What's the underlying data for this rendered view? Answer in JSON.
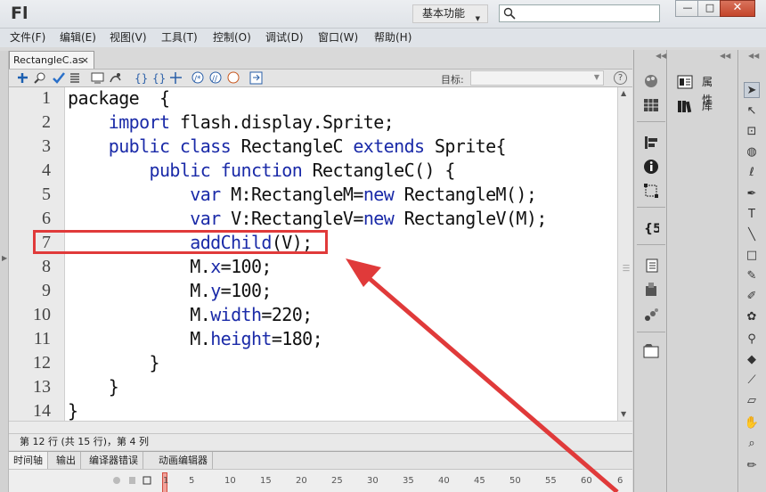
{
  "titlebar": {
    "logo": "Fl",
    "workspace": "基本功能",
    "window_buttons": {
      "minimize": "—",
      "maximize": "□",
      "close": "✕"
    }
  },
  "menubar": [
    "文件(F)",
    "编辑(E)",
    "视图(V)",
    "工具(T)",
    "控制(O)",
    "调试(D)",
    "窗口(W)",
    "帮助(H)"
  ],
  "document_tab": {
    "label": "RectangleC.as",
    "close": "×"
  },
  "toolbar": {
    "target_label": "目标:",
    "target_value": "",
    "help": "?"
  },
  "editor": {
    "line_numbers": [
      "1",
      "2",
      "3",
      "4",
      "5",
      "6",
      "7",
      "8",
      "9",
      "10",
      "11",
      "12",
      "13",
      "14"
    ],
    "highlighted_line": 7,
    "lines": [
      [
        {
          "t": "package  {",
          "k": false
        }
      ],
      [
        {
          "t": "    ",
          "k": false
        },
        {
          "t": "import",
          "k": true
        },
        {
          "t": " flash.display.Sprite;",
          "k": false
        }
      ],
      [
        {
          "t": "    ",
          "k": false
        },
        {
          "t": "public class",
          "k": true
        },
        {
          "t": " RectangleC ",
          "k": false
        },
        {
          "t": "extends",
          "k": true
        },
        {
          "t": " Sprite{",
          "k": false
        }
      ],
      [
        {
          "t": "        ",
          "k": false
        },
        {
          "t": "public function",
          "k": true
        },
        {
          "t": " RectangleC() {",
          "k": false
        }
      ],
      [
        {
          "t": "            ",
          "k": false
        },
        {
          "t": "var",
          "k": true
        },
        {
          "t": " M:RectangleM=",
          "k": false
        },
        {
          "t": "new",
          "k": true
        },
        {
          "t": " RectangleM();",
          "k": false
        }
      ],
      [
        {
          "t": "            ",
          "k": false
        },
        {
          "t": "var",
          "k": true
        },
        {
          "t": " V:RectangleV=",
          "k": false
        },
        {
          "t": "new",
          "k": true
        },
        {
          "t": " RectangleV(M);",
          "k": false
        }
      ],
      [
        {
          "t": "            ",
          "k": false
        },
        {
          "t": "addChild",
          "k": true
        },
        {
          "t": "(V);",
          "k": false
        }
      ],
      [
        {
          "t": "            M.",
          "k": false
        },
        {
          "t": "x",
          "k": true
        },
        {
          "t": "=100;",
          "k": false
        }
      ],
      [
        {
          "t": "            M.",
          "k": false
        },
        {
          "t": "y",
          "k": true
        },
        {
          "t": "=100;",
          "k": false
        }
      ],
      [
        {
          "t": "            M.",
          "k": false
        },
        {
          "t": "width",
          "k": true
        },
        {
          "t": "=220;",
          "k": false
        }
      ],
      [
        {
          "t": "            M.",
          "k": false
        },
        {
          "t": "height",
          "k": true
        },
        {
          "t": "=180;",
          "k": false
        }
      ],
      [
        {
          "t": "        }",
          "k": false
        }
      ],
      [
        {
          "t": "    }",
          "k": false
        }
      ],
      [
        {
          "t": "}",
          "k": false
        }
      ]
    ]
  },
  "status": "第 12 行 (共 15 行)，第 4 列",
  "bottom_tabs": [
    "时间轴",
    "输出",
    "编译器错误",
    "动画编辑器"
  ],
  "timeline": {
    "frames": [
      "1",
      "5",
      "10",
      "15",
      "20",
      "25",
      "30",
      "35",
      "40",
      "45",
      "50",
      "55",
      "60",
      "6"
    ]
  },
  "panels": {
    "properties": "属性",
    "library": "库"
  },
  "colors": {
    "keyword": "#1a2aa8",
    "highlight": "#e03a3a",
    "chrome": "#d5d5d5"
  }
}
